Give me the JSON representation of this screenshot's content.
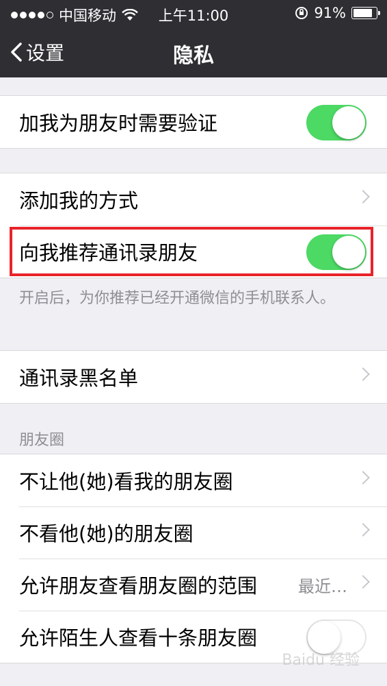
{
  "status_bar": {
    "carrier": "中国移动",
    "time": "上午11:00",
    "battery_percent": "91%",
    "battery_level": 0.91,
    "signal_bars": 4,
    "signal_max": 5
  },
  "nav": {
    "back_label": "设置",
    "title": "隐私"
  },
  "group1": {
    "verify_label": "加我为朋友时需要验证",
    "verify_on": true
  },
  "group2": {
    "add_methods_label": "添加我的方式",
    "recommend_label": "向我推荐通讯录朋友",
    "recommend_on": true,
    "footnote": "开启后，为你推荐已经开通微信的手机联系人。"
  },
  "group3": {
    "blacklist_label": "通讯录黑名单"
  },
  "moments": {
    "header": "朋友圈",
    "block_label": "不让他(她)看我的朋友圈",
    "hide_label": "不看他(她)的朋友圈",
    "range_label": "允许朋友查看朋友圈的范围",
    "range_value": "最近…",
    "stranger_label": "允许陌生人查看十条朋友圈",
    "stranger_on": false
  },
  "watermark": "Baidu 经验",
  "colors": {
    "nav_bg": "#2e2e33",
    "switch_on": "#4cd964",
    "highlight": "#e8232a"
  }
}
